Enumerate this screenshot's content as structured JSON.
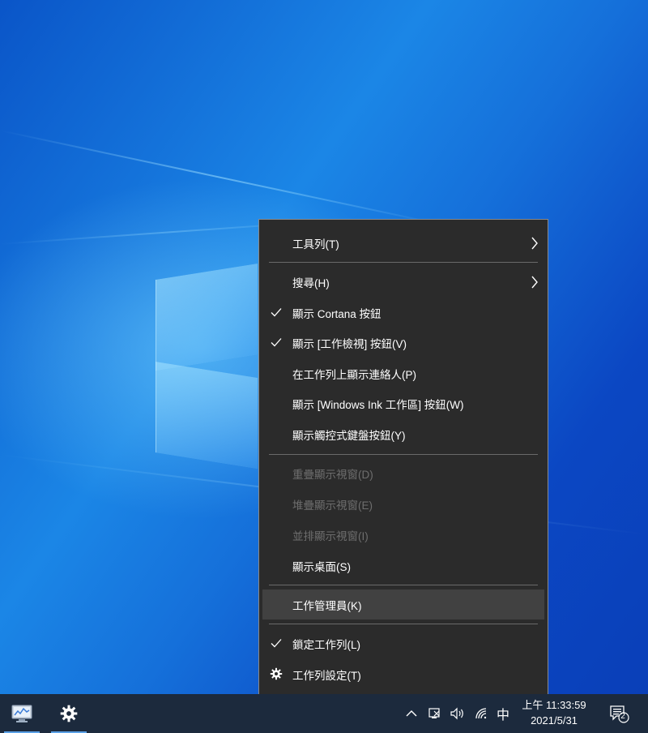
{
  "desktop": {
    "wallpaper": "windows-10-hero",
    "colors": {
      "deep_blue": "#0a3fb8",
      "light_blue": "#1b86e6"
    }
  },
  "context_menu": {
    "items": [
      {
        "label": "工具列(T)",
        "has_submenu": true,
        "checked": false,
        "enabled": true
      },
      {
        "label": "搜尋(H)",
        "has_submenu": true,
        "checked": false,
        "enabled": true
      },
      {
        "label": "顯示 Cortana 按鈕",
        "has_submenu": false,
        "checked": true,
        "enabled": true
      },
      {
        "label": "顯示 [工作檢視] 按鈕(V)",
        "has_submenu": false,
        "checked": true,
        "enabled": true
      },
      {
        "label": "在工作列上顯示連絡人(P)",
        "has_submenu": false,
        "checked": false,
        "enabled": true
      },
      {
        "label": "顯示 [Windows Ink 工作區] 按鈕(W)",
        "has_submenu": false,
        "checked": false,
        "enabled": true
      },
      {
        "label": "顯示觸控式鍵盤按鈕(Y)",
        "has_submenu": false,
        "checked": false,
        "enabled": true
      },
      {
        "label": "重疊顯示視窗(D)",
        "has_submenu": false,
        "checked": false,
        "enabled": false
      },
      {
        "label": "堆疊顯示視窗(E)",
        "has_submenu": false,
        "checked": false,
        "enabled": false
      },
      {
        "label": "並排顯示視窗(I)",
        "has_submenu": false,
        "checked": false,
        "enabled": false
      },
      {
        "label": "顯示桌面(S)",
        "has_submenu": false,
        "checked": false,
        "enabled": true
      },
      {
        "label": "工作管理員(K)",
        "has_submenu": false,
        "checked": false,
        "enabled": true,
        "highlighted": true
      },
      {
        "label": "鎖定工作列(L)",
        "has_submenu": false,
        "checked": true,
        "enabled": true
      },
      {
        "label": "工作列設定(T)",
        "has_submenu": false,
        "checked": false,
        "enabled": true,
        "icon": "gear-icon"
      }
    ],
    "colors": {
      "background": "#2b2b2b",
      "text": "#ffffff",
      "disabled_text": "#6e6e6e",
      "highlight": "#414141"
    }
  },
  "taskbar": {
    "pinned_apps": [
      {
        "name": "resource-monitor-app",
        "icon": "monitor-chart-icon",
        "active": true
      },
      {
        "name": "settings-app",
        "icon": "gear-icon",
        "active": true
      }
    ],
    "tray": {
      "ime_indicator": "中",
      "notification_count": "2",
      "icons": [
        "chevron-up-icon",
        "network-disconnected-icon",
        "volume-icon",
        "wifi-icon"
      ]
    },
    "clock": {
      "time": "上午 11:33:59",
      "date": "2021/5/31"
    },
    "colors": {
      "background": "#1c2a3d",
      "active_indicator": "#5aa0e6"
    }
  }
}
